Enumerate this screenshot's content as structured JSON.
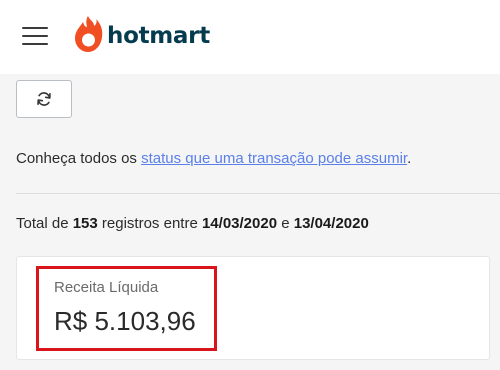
{
  "header": {
    "menu_icon": "hamburger-menu-icon",
    "logo_icon": "flame-icon",
    "logo_text": "hotmart",
    "brand_color": "#f04e23",
    "logo_text_color": "#053b4e"
  },
  "toolbar": {
    "refresh_icon": "refresh-icon"
  },
  "info": {
    "prefix": "Conheça todos os ",
    "link_text": "status que uma transação pode assumir",
    "suffix": ".",
    "link_color": "#5b80e8"
  },
  "summary": {
    "text1": "Total de ",
    "count": "153",
    "text2": " registros entre ",
    "start_date": "14/03/2020",
    "text3": " e ",
    "end_date": "13/04/2020"
  },
  "card": {
    "label": "Receita Líquida",
    "value": "R$ 5.103,96",
    "highlight_color": "#d9141b"
  }
}
